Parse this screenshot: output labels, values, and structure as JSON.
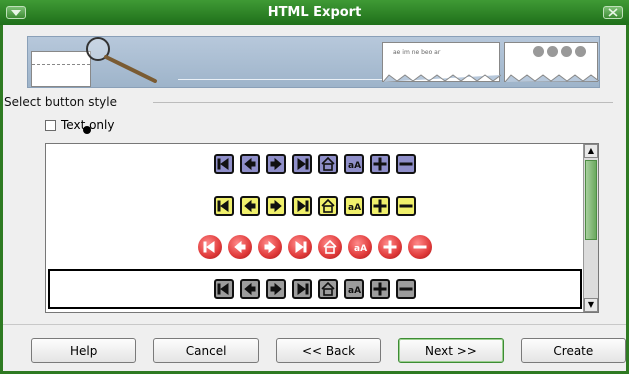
{
  "window": {
    "title": "HTML Export"
  },
  "banner": {
    "card1_text": "ae im ne beo ar"
  },
  "section": {
    "label": "Select button style"
  },
  "options": {
    "text_only_label": "Text only",
    "text_only_checked": false
  },
  "list": {
    "rows": [
      {
        "style": "blue",
        "fill": "#8f8fc9",
        "border": "#111"
      },
      {
        "style": "yellow",
        "fill": "#f0f06c",
        "border": "#111"
      },
      {
        "style": "red",
        "fill": "#e03a3a",
        "border": "#c22"
      },
      {
        "style": "gray",
        "fill": "#9c9c9c",
        "border": "#111"
      }
    ],
    "icons": [
      "first-icon",
      "prev-icon",
      "next-icon",
      "last-icon",
      "home-icon",
      "text-size-icon",
      "plus-icon",
      "minus-icon"
    ],
    "text_size_glyph": "aA"
  },
  "buttons": {
    "help": "Help",
    "cancel": "Cancel",
    "back": "<< Back",
    "next": "Next >>",
    "create": "Create"
  },
  "colors": {
    "title_bar": "#2e7a22",
    "accent": "#3d8c34"
  }
}
